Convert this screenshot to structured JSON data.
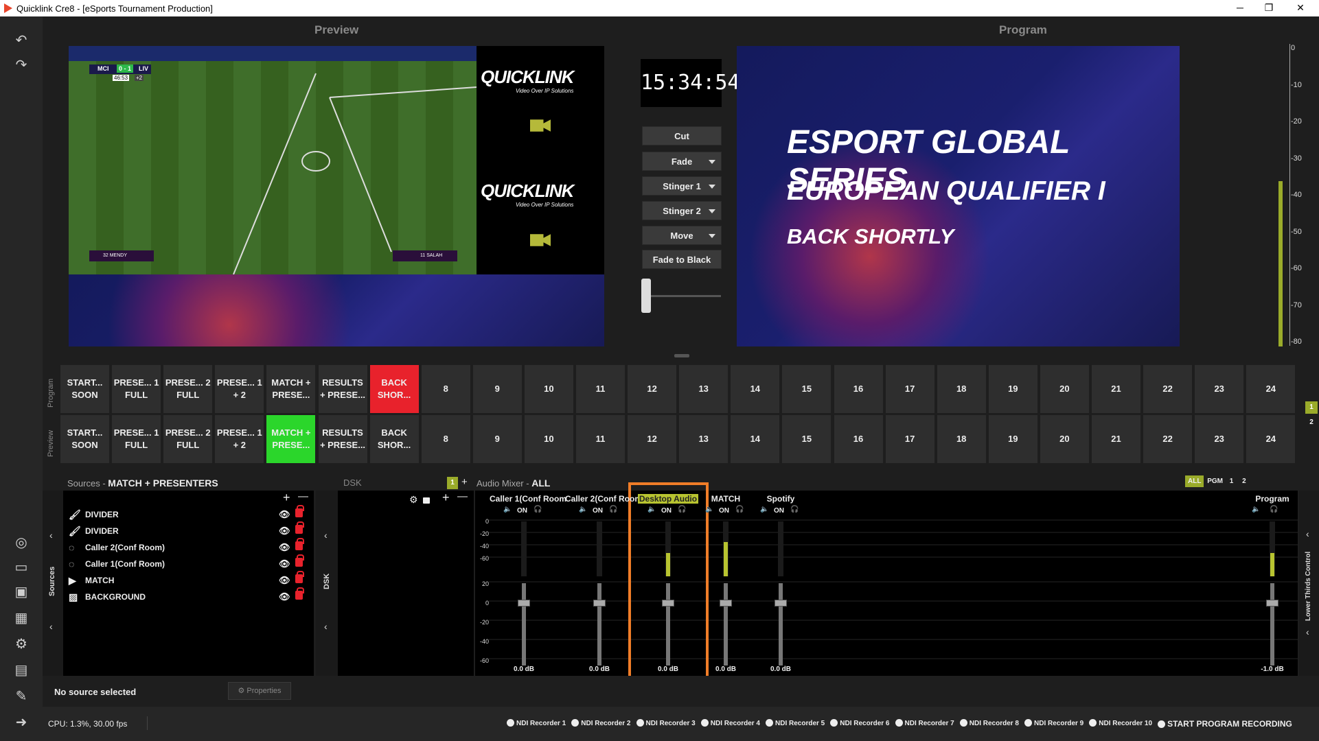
{
  "window": {
    "title": "Quicklink Cre8 - [eSports Tournament Production]",
    "min": "─",
    "max": "❐",
    "close": "✕"
  },
  "sidebar": {
    "undo": "↶",
    "redo": "↷",
    "icons": [
      "◎",
      "▭",
      "▣",
      "▦",
      "⚙",
      "▤",
      "✎",
      "➜"
    ]
  },
  "preview": {
    "header": "Preview",
    "scoreboard": {
      "home": "MCI",
      "score": "0 - 1",
      "away": "LIV",
      "clock": "46:53",
      "added": "+2"
    },
    "player_left": "32 MENDY",
    "player_right": "11 SALAH",
    "logo_text": "QUICKLINK",
    "logo_sub": "Video Over IP Solutions"
  },
  "program": {
    "header": "Program",
    "line1": "ESPORT GLOBAL SERIES",
    "line2": "EUROPEAN QUALIFIER I",
    "line3": "BACK SHORTLY"
  },
  "clock": "15:34:54",
  "transitions": [
    {
      "label": "Cut",
      "dropdown": false
    },
    {
      "label": "Fade",
      "dropdown": true
    },
    {
      "label": "Stinger 1",
      "dropdown": true
    },
    {
      "label": "Stinger 2",
      "dropdown": true
    },
    {
      "label": "Move",
      "dropdown": true
    },
    {
      "label": "Fade to Black",
      "dropdown": false
    }
  ],
  "vu_scale": [
    "0",
    "-10",
    "-20",
    "-30",
    "-40",
    "-50",
    "-60",
    "-70",
    "-80"
  ],
  "scene_rows": {
    "program_label": "Program",
    "preview_label": "Preview",
    "program": [
      "START... SOON",
      "PRESE... 1 FULL",
      "PRESE... 2 FULL",
      "PRESE... 1 + 2",
      "MATCH + PRESE...",
      "RESULTS + PRESE...",
      "BACK SHOR...",
      "8",
      "9",
      "10",
      "11",
      "12",
      "13",
      "14",
      "15",
      "16",
      "17",
      "18",
      "19",
      "20",
      "21",
      "22",
      "23",
      "24"
    ],
    "preview": [
      "START... SOON",
      "PRESE... 1 FULL",
      "PRESE... 2 FULL",
      "PRESE... 1 + 2",
      "MATCH + PRESE...",
      "RESULTS + PRESE...",
      "BACK SHOR...",
      "8",
      "9",
      "10",
      "11",
      "12",
      "13",
      "14",
      "15",
      "16",
      "17",
      "18",
      "19",
      "20",
      "21",
      "22",
      "23",
      "24"
    ],
    "program_active_index": 6,
    "preview_active_index": 4,
    "program_active_color": "#e8222c",
    "preview_active_color": "#2bd62b",
    "page_1": "1",
    "page_2": "2"
  },
  "sources": {
    "title": "Sources",
    "separator": "-",
    "scene": "MATCH + PRESENTERS",
    "side_label": "Sources",
    "plus": "+",
    "minus": "—",
    "items": [
      {
        "icon": "brush-icon",
        "glyph": "🖌",
        "label": "DIVIDER"
      },
      {
        "icon": "brush-icon",
        "glyph": "🖌",
        "label": "DIVIDER"
      },
      {
        "icon": "ndi-icon",
        "glyph": "◌",
        "label": "Caller 2(Conf Room)"
      },
      {
        "icon": "ndi-icon",
        "glyph": "◌",
        "label": "Caller 1(Conf Room)"
      },
      {
        "icon": "play-icon",
        "glyph": "▶",
        "label": "MATCH"
      },
      {
        "icon": "image-icon",
        "glyph": "▨",
        "label": "BACKGROUND"
      }
    ]
  },
  "dsk": {
    "title": "DSK",
    "side_label": "DSK",
    "page": "1",
    "plus": "+"
  },
  "audio": {
    "title": "Audio Mixer",
    "separator": "-",
    "filter": "ALL",
    "tabs": [
      "ALL",
      "PGM",
      "1",
      "2"
    ],
    "on": "ON",
    "scale": [
      "0",
      "-20",
      "-40",
      "-60",
      "20",
      "0",
      "-20",
      "-40",
      "-60"
    ],
    "channels": [
      {
        "name": "Caller 1(Conf Room",
        "db": "0.0 dB",
        "level": 0
      },
      {
        "name": "Caller 2(Conf Room",
        "db": "0.0 dB",
        "level": 0
      },
      {
        "name": "Desktop Audio",
        "db": "0.0 dB",
        "level": 0.42,
        "highlight": true
      },
      {
        "name": "MATCH",
        "db": "0.0 dB",
        "level": 0.62
      },
      {
        "name": "Spotify",
        "db": "0.0 dB",
        "level": 0
      }
    ],
    "program": {
      "name": "Program",
      "db": "-1.0 dB",
      "level": 0.42
    },
    "highlight_color": "#f07d28",
    "meter_color": "#b8c430"
  },
  "lower_thirds": "Lower Thirds Control",
  "status": {
    "no_source": "No source selected",
    "properties": "Properties",
    "cpu": "CPU: 1.3%, 30.00 fps"
  },
  "recorders": [
    "NDI Recorder 1",
    "NDI Recorder 2",
    "NDI Recorder 3",
    "NDI Recorder 4",
    "NDI Recorder 5",
    "NDI Recorder 6",
    "NDI Recorder 7",
    "NDI Recorder 8",
    "NDI Recorder 9",
    "NDI Recorder 10"
  ],
  "start_recording": "START PROGRAM RECORDING"
}
